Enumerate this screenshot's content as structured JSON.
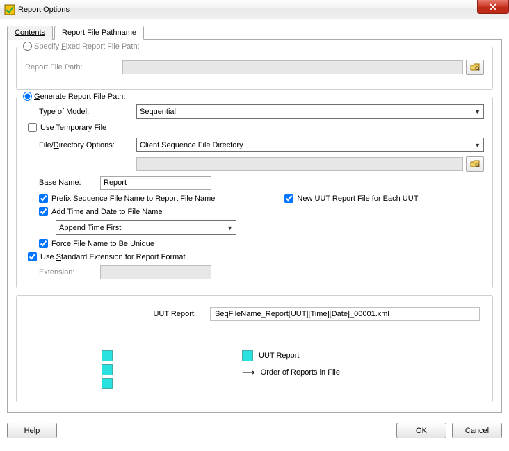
{
  "window": {
    "title": "Report Options"
  },
  "tabs": {
    "contents": "Contents",
    "pathname": "Report File Pathname"
  },
  "group_fixed": {
    "legend": "Specify Fixed Report File Path:",
    "legend_u": "F",
    "file_path_label": "Report File Path:"
  },
  "group_gen": {
    "legend": "Generate Report File Path:",
    "type_of_model_label": "Type of Model:",
    "type_of_model_value": "Sequential",
    "use_temp": "Use Temporary File",
    "file_dir_label": "File/Directory Options:",
    "file_dir_value": "Client Sequence File Directory",
    "base_name_label": "Base Name:",
    "base_name_value": "Report",
    "prefix_seq": "Prefix Sequence File Name to Report File Name",
    "new_uut": "New UUT Report File for Each UUT",
    "add_time": "Add Time and Date to File Name",
    "append_value": "Append Time First",
    "force_unique": "Force File Name to Be Unique",
    "use_std_ext": "Use Standard Extension for Report Format",
    "extension_label": "Extension:"
  },
  "preview": {
    "uut_report_label": "UUT Report:",
    "uut_report_value": "SeqFileName_Report[UUT][Time][Date]_00001.xml",
    "legend_uut": "UUT Report",
    "legend_order": "Order of Reports in File"
  },
  "footer": {
    "help": "Help",
    "ok": "OK",
    "cancel": "Cancel"
  }
}
